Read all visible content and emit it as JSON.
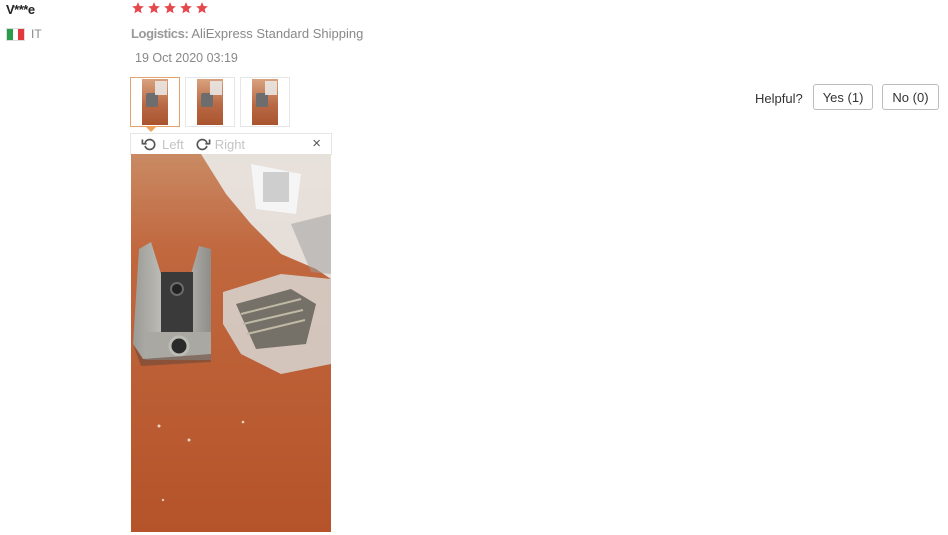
{
  "review": {
    "user_name": "V***e",
    "country_code": "IT",
    "rating": 5,
    "star_color": "#e5484d",
    "logistics_label": "Logistics:",
    "logistics_value": "AliExpress Standard Shipping",
    "date": "19 Oct 2020 03:19"
  },
  "thumbnails": [
    {
      "name": "photo-1",
      "active": true
    },
    {
      "name": "photo-2",
      "active": false
    },
    {
      "name": "photo-3",
      "active": false
    }
  ],
  "viewer": {
    "rotate_left_label": "Left",
    "rotate_right_label": "Right",
    "close_glyph": "×"
  },
  "helpful": {
    "label": "Helpful?",
    "yes_label": "Yes (1)",
    "no_label": "No (0)"
  },
  "colors": {
    "accent_border": "#e3a36a",
    "caret": "#f0a35a",
    "muted_text": "#888888"
  }
}
